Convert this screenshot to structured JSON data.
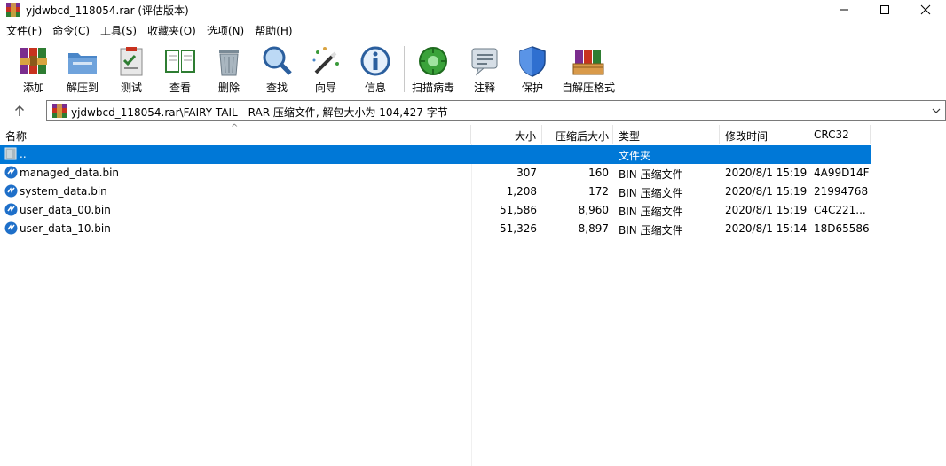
{
  "window": {
    "title": "yjdwbcd_118054.rar (评估版本)"
  },
  "menu": [
    {
      "label": "文件(F)"
    },
    {
      "label": "命令(C)"
    },
    {
      "label": "工具(S)"
    },
    {
      "label": "收藏夹(O)"
    },
    {
      "label": "选项(N)"
    },
    {
      "label": "帮助(H)"
    }
  ],
  "toolbar": {
    "buttons": [
      {
        "label": "添加",
        "icon": "add-books-icon"
      },
      {
        "label": "解压到",
        "icon": "extract-folder-icon"
      },
      {
        "label": "测试",
        "icon": "test-clipboard-icon"
      },
      {
        "label": "查看",
        "icon": "view-book-icon"
      },
      {
        "label": "删除",
        "icon": "trash-icon"
      },
      {
        "label": "查找",
        "icon": "magnifier-icon"
      },
      {
        "label": "向导",
        "icon": "wizard-wand-icon"
      },
      {
        "label": "信息",
        "icon": "info-icon"
      },
      {
        "label": "扫描病毒",
        "icon": "virus-scan-icon"
      },
      {
        "label": "注释",
        "icon": "comment-icon"
      },
      {
        "label": "保护",
        "icon": "shield-icon"
      },
      {
        "label": "自解压格式",
        "icon": "sfx-box-icon"
      }
    ]
  },
  "path": {
    "text": "yjdwbcd_118054.rar\\FAIRY TAIL - RAR 压缩文件, 解包大小为 104,427 字节"
  },
  "columns": {
    "name": "名称",
    "size": "大小",
    "packed": "压缩后大小",
    "type": "类型",
    "modified": "修改时间",
    "crc": "CRC32"
  },
  "rows": [
    {
      "name": "..",
      "size": "",
      "packed": "",
      "type": "文件夹",
      "modified": "",
      "crc": "",
      "selected": true
    },
    {
      "name": "managed_data.bin",
      "size": "307",
      "packed": "160",
      "type": "BIN 压缩文件",
      "modified": "2020/8/1 15:19",
      "crc": "4A99D14F"
    },
    {
      "name": "system_data.bin",
      "size": "1,208",
      "packed": "172",
      "type": "BIN 压缩文件",
      "modified": "2020/8/1 15:19",
      "crc": "21994768"
    },
    {
      "name": "user_data_00.bin",
      "size": "51,586",
      "packed": "8,960",
      "type": "BIN 压缩文件",
      "modified": "2020/8/1 15:19",
      "crc": "C4C221..."
    },
    {
      "name": "user_data_10.bin",
      "size": "51,326",
      "packed": "8,897",
      "type": "BIN 压缩文件",
      "modified": "2020/8/1 15:14",
      "crc": "18D65586"
    }
  ],
  "colors": {
    "selection": "#0078d7",
    "file_icon": "#1e6fc9"
  }
}
